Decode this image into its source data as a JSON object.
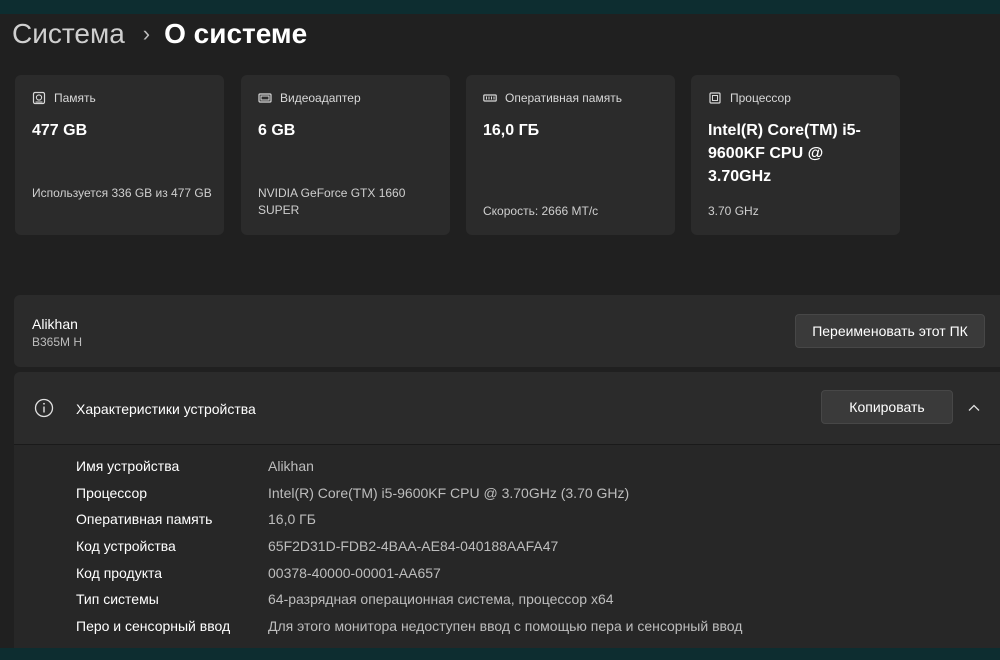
{
  "breadcrumb": {
    "parent": "Система",
    "separator": "›",
    "current": "О системе"
  },
  "cards": [
    {
      "icon": "storage-icon",
      "title": "Память",
      "value": "477 GB",
      "sub": "Используется 336 GB из 477 GB"
    },
    {
      "icon": "gpu-icon",
      "title": "Видеоадаптер",
      "value": "6 GB",
      "sub": "NVIDIA GeForce GTX 1660 SUPER"
    },
    {
      "icon": "ram-icon",
      "title": "Оперативная память",
      "value": "16,0 ГБ",
      "sub": "Скорость: 2666 MT/c"
    },
    {
      "icon": "cpu-icon",
      "title": "Процессор",
      "value": "Intel(R) Core(TM) i5-9600KF CPU @ 3.70GHz",
      "sub": "3.70 GHz"
    }
  ],
  "pc": {
    "name": "Alikhan",
    "model": "B365M H",
    "rename_label": "Переименовать этот ПК"
  },
  "specs": {
    "title": "Характеристики устройства",
    "copy_label": "Копировать",
    "rows": [
      {
        "label": "Имя устройства",
        "value": "Alikhan"
      },
      {
        "label": "Процессор",
        "value": "Intel(R) Core(TM) i5-9600KF CPU @ 3.70GHz (3.70 GHz)"
      },
      {
        "label": "Оперативная память",
        "value": "16,0 ГБ"
      },
      {
        "label": "Код устройства",
        "value": "65F2D31D-FDB2-4BAA-AE84-040188AAFA47"
      },
      {
        "label": "Код продукта",
        "value": "00378-40000-00001-AA657"
      },
      {
        "label": "Тип системы",
        "value": "64-разрядная операционная система, процессор x64"
      },
      {
        "label": "Перо и сенсорный ввод",
        "value": "Для этого монитора недоступен ввод с помощью пера и сенсорный ввод"
      }
    ]
  },
  "colors": {
    "background": "#202020",
    "card": "#2b2b2b",
    "strip": "#0d2d30"
  }
}
